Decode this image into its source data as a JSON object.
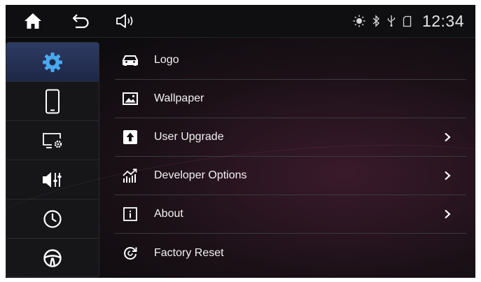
{
  "topbar": {
    "icons": [
      "home-icon",
      "back-icon",
      "speaker-icon"
    ],
    "status_icons": [
      "brightness-icon",
      "bluetooth-icon",
      "usb-icon",
      "sd-card-icon"
    ],
    "time": "12:34"
  },
  "sidebar": {
    "active_index": 0,
    "items": [
      {
        "icon": "gear-icon"
      },
      {
        "icon": "phone-icon"
      },
      {
        "icon": "display-settings-icon"
      },
      {
        "icon": "audio-eq-icon"
      },
      {
        "icon": "clock-icon"
      },
      {
        "icon": "steering-wheel-icon"
      }
    ]
  },
  "menu": {
    "items": [
      {
        "label": "Logo",
        "icon": "car-icon",
        "has_arrow": false
      },
      {
        "label": "Wallpaper",
        "icon": "image-icon",
        "has_arrow": false
      },
      {
        "label": "User Upgrade",
        "icon": "upload-icon",
        "has_arrow": true
      },
      {
        "label": "Developer Options",
        "icon": "chart-icon",
        "has_arrow": true
      },
      {
        "label": "About",
        "icon": "info-icon",
        "has_arrow": true
      },
      {
        "label": "Factory Reset",
        "icon": "reset-icon",
        "has_arrow": false
      }
    ]
  },
  "colors": {
    "accent": "#2e3b63",
    "text": "#f2f2f2",
    "background": "#0b0b0e"
  }
}
